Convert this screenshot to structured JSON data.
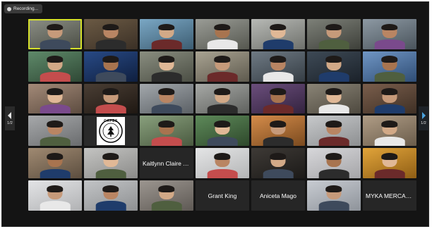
{
  "recording": {
    "label": "Recording..."
  },
  "pagination": {
    "left": "1/2",
    "right": "1/2"
  },
  "accent_colors": {
    "active_speaker_border": "#d6e12a",
    "window_bg": "#141414",
    "tile_bg": "#262626"
  },
  "logo": {
    "text": "CAPES"
  },
  "tiles": [
    {
      "type": "video",
      "active": true
    },
    {
      "type": "video"
    },
    {
      "type": "video"
    },
    {
      "type": "video"
    },
    {
      "type": "video"
    },
    {
      "type": "video"
    },
    {
      "type": "video"
    },
    {
      "type": "video"
    },
    {
      "type": "video"
    },
    {
      "type": "video"
    },
    {
      "type": "video"
    },
    {
      "type": "video"
    },
    {
      "type": "video"
    },
    {
      "type": "video"
    },
    {
      "type": "video"
    },
    {
      "type": "video"
    },
    {
      "type": "video"
    },
    {
      "type": "video"
    },
    {
      "type": "video"
    },
    {
      "type": "video"
    },
    {
      "type": "video"
    },
    {
      "type": "video"
    },
    {
      "type": "logo"
    },
    {
      "type": "video"
    },
    {
      "type": "video"
    },
    {
      "type": "video"
    },
    {
      "type": "video"
    },
    {
      "type": "video"
    },
    {
      "type": "video"
    },
    {
      "type": "video"
    },
    {
      "type": "name",
      "name": "Kaitlynn Claire E..."
    },
    {
      "type": "video"
    },
    {
      "type": "video"
    },
    {
      "type": "video"
    },
    {
      "type": "video"
    },
    {
      "type": "video"
    },
    {
      "type": "video"
    },
    {
      "type": "video"
    },
    {
      "type": "name",
      "name": "Grant King"
    },
    {
      "type": "name",
      "name": "Aniceta Mago"
    },
    {
      "type": "video"
    },
    {
      "type": "name",
      "name": "MYKA MERCADO"
    }
  ]
}
